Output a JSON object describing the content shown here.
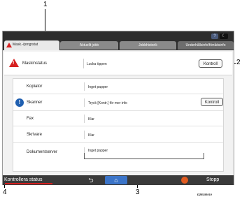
{
  "callouts": [
    "1",
    "2",
    "3",
    "4"
  ],
  "tabs": [
    {
      "label": "Mask.-/prngrstat"
    },
    {
      "label": "Aktuellt jobb"
    },
    {
      "label": "Jobbhistorik"
    },
    {
      "label": "Underhållsinfo/förrådsinfo"
    }
  ],
  "header_icons": {
    "help": "?",
    "night": "☾"
  },
  "machine_status": {
    "label": "Maskinstatus",
    "value": "Lucka öppen",
    "button": "Kontroll"
  },
  "devices": [
    {
      "label": "Kopiator",
      "value": "Inget papper"
    },
    {
      "label": "Skanner",
      "value": "Tryck [Kontr.] för mer info",
      "button": "Kontroll"
    },
    {
      "label": "Fax",
      "value": "Klar"
    },
    {
      "label": "Skrivare",
      "value": "Klar"
    },
    {
      "label": "Dokumentserver",
      "value": "Inget papper"
    }
  ],
  "bottom_bar": {
    "status_check": "Kontrollera status",
    "back": "⮌",
    "home": "⌂",
    "stop": "Stopp"
  },
  "figure_code": "DZE155 SV",
  "colors": {
    "warning": "#d62020",
    "info": "#1f5fb0",
    "home": "#3b74c8",
    "stop": "#e05a1f"
  },
  "icons": [
    "warning-icon",
    "info-icon",
    "help-icon",
    "night-mode-icon",
    "back-icon",
    "home-icon",
    "stop-icon"
  ]
}
